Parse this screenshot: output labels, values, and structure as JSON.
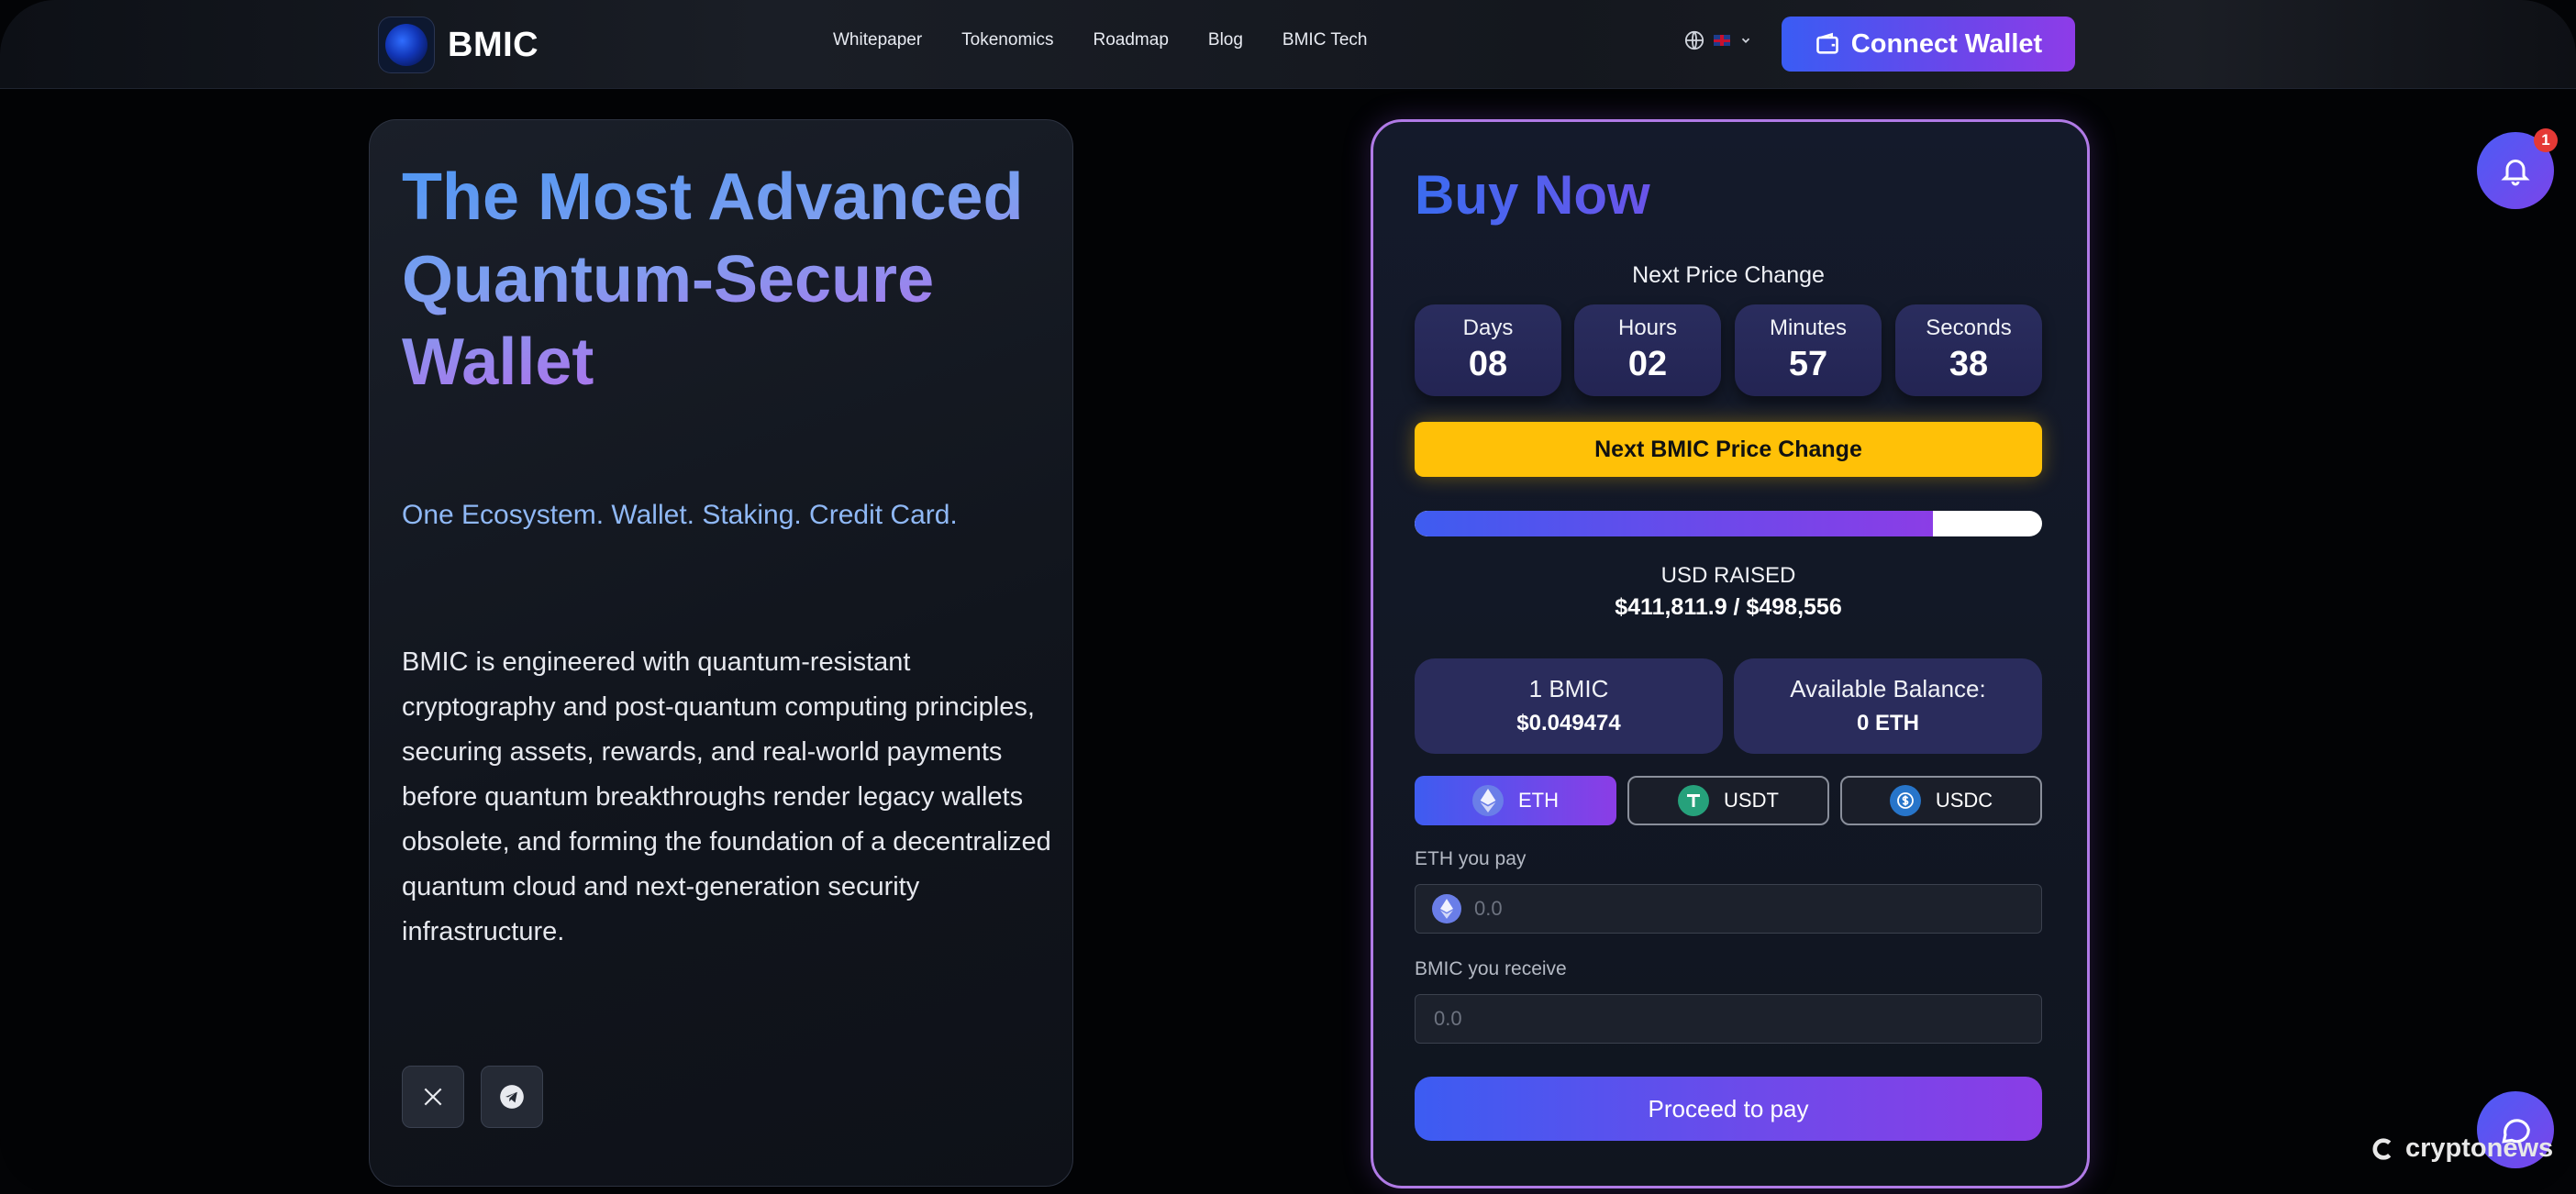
{
  "header": {
    "brand": "BMIC",
    "nav": [
      "Whitepaper",
      "Tokenomics",
      "Roadmap",
      "Blog",
      "BMIC Tech"
    ],
    "connect_label": "Connect Wallet"
  },
  "hero": {
    "title_line1": "The Most Advanced",
    "title_line2": "Quantum-Secure",
    "title_line3": "Wallet",
    "subline": "One Ecosystem. Wallet. Staking. Credit Card.",
    "description": "BMIC is engineered with quantum-resistant cryptography and post-quantum computing principles, securing assets, rewards, and real-world payments before quantum breakthroughs render legacy wallets obsolete, and forming the foundation of a decentralized quantum cloud and next-generation security infrastructure."
  },
  "buy": {
    "title": "Buy Now",
    "next_price_change": "Next Price Change",
    "countdown": [
      {
        "label": "Days",
        "value": "08"
      },
      {
        "label": "Hours",
        "value": "02"
      },
      {
        "label": "Minutes",
        "value": "57"
      },
      {
        "label": "Seconds",
        "value": "38"
      }
    ],
    "price_change_button": "Next BMIC Price Change",
    "progress_fraction": 0.826,
    "raised_label": "USD RAISED",
    "raised_value": "$411,811.9 / $498,556",
    "rate_label": "1 BMIC",
    "rate_value": "$0.049474",
    "balance_label": "Available Balance:",
    "balance_value": "0 ETH",
    "tokens": [
      {
        "label": "ETH",
        "icon": "eth-icon",
        "active": true
      },
      {
        "label": "USDT",
        "icon": "tether-icon",
        "active": false
      },
      {
        "label": "USDC",
        "icon": "usdc-icon",
        "active": false
      }
    ],
    "pay_label": "ETH you pay",
    "pay_placeholder": "0.0",
    "receive_label": "BMIC you receive",
    "receive_placeholder": "0.0",
    "proceed_label": "Proceed to pay"
  },
  "notifications": {
    "count": "1"
  },
  "watermark": "cryptonews",
  "colors": {
    "accent_blue": "#3e5cf0",
    "accent_purple": "#8b3de6",
    "yellow": "#ffc107",
    "card_border": "#b07ae6"
  }
}
